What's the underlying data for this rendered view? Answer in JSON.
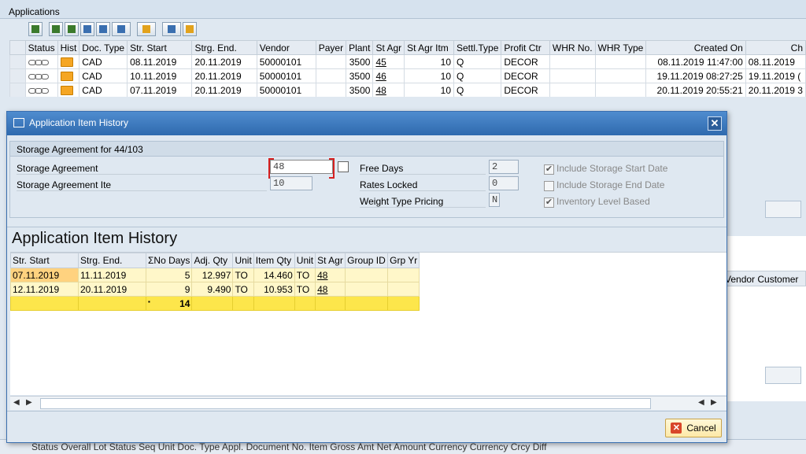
{
  "apps": {
    "title": "Applications",
    "columns": [
      "",
      "Status",
      "Hist",
      "Doc. Type",
      "Str. Start",
      "Strg. End.",
      "Vendor",
      "Payer",
      "Plant",
      "St Agr",
      "St Agr Itm",
      "Settl.Type",
      "Profit Ctr",
      "WHR No.",
      "WHR Type",
      "Created On",
      "Ch"
    ],
    "rows": [
      {
        "doc_type": "CAD",
        "str_start": "08.11.2019",
        "strg_end": "20.11.2019",
        "vendor": "50000101",
        "plant": "3500",
        "st_agr": "45",
        "st_agr_itm": "10",
        "settl": "Q",
        "profit_ctr": "DECOR",
        "created_on": "08.11.2019 11:47:00",
        "ch": "08.11.2019"
      },
      {
        "doc_type": "CAD",
        "str_start": "10.11.2019",
        "strg_end": "20.11.2019",
        "vendor": "50000101",
        "plant": "3500",
        "st_agr": "46",
        "st_agr_itm": "10",
        "settl": "Q",
        "profit_ctr": "DECOR",
        "created_on": "19.11.2019 08:27:25",
        "ch": "19.11.2019 ("
      },
      {
        "doc_type": "CAD",
        "str_start": "07.11.2019",
        "strg_end": "20.11.2019",
        "vendor": "50000101",
        "plant": "3500",
        "st_agr": "48",
        "st_agr_itm": "10",
        "settl": "Q",
        "profit_ctr": "DECOR",
        "created_on": "20.11.2019 20:55:21",
        "ch": "20.11.2019 3"
      }
    ],
    "panel2_header": "Vendor Customer",
    "bottom_header": "Status Overall Lot Status Seq Unit Doc. Type Appl. Document No. Item Gross Amt Net Amount Currency Currency Crcy Diff"
  },
  "dialog": {
    "title": "Application Item History",
    "section_title": "Storage Agreement for 44/103",
    "storage_agreement_label": "Storage Agreement",
    "storage_agreement_value": "48",
    "storage_agreement_item_label": "Storage Agreement Ite",
    "storage_agreement_item_value": "10",
    "free_days_label": "Free Days",
    "free_days_value": "2",
    "rates_locked_label": "Rates Locked",
    "rates_locked_value": "0",
    "weight_type_label": "Weight Type Pricing",
    "weight_type_value": "N",
    "include_start_label": "Include Storage Start Date",
    "include_end_label": "Include Storage End Date",
    "inventory_level_label": "Inventory Level Based",
    "checks": {
      "include_start": true,
      "include_end": false,
      "inventory_level": true
    },
    "history_title": "Application Item History",
    "history_columns": [
      "Str. Start",
      "Strg. End.",
      "ΣNo Days",
      "Adj. Qty",
      "Unit",
      "Item Qty",
      "Unit",
      "St Agr",
      "Group ID",
      "Grp Yr"
    ],
    "history_rows": [
      {
        "str_start": "07.11.2019",
        "strg_end": "11.11.2019",
        "no_days": "5",
        "adj_qty": "12.997",
        "unit1": "TO",
        "item_qty": "14.460",
        "unit2": "TO",
        "st_agr": "48"
      },
      {
        "str_start": "12.11.2019",
        "strg_end": "20.11.2019",
        "no_days": "9",
        "adj_qty": "9.490",
        "unit1": "TO",
        "item_qty": "10.953",
        "unit2": "TO",
        "st_agr": "48"
      }
    ],
    "total_marker": "▪",
    "total_days": "14",
    "cancel_label": "Cancel"
  },
  "colors": {
    "title_bar": "#2f6aae",
    "row_highlight": "#fff7c9",
    "total_row": "#fde64b",
    "cancel_btn": "#fde9a8"
  }
}
